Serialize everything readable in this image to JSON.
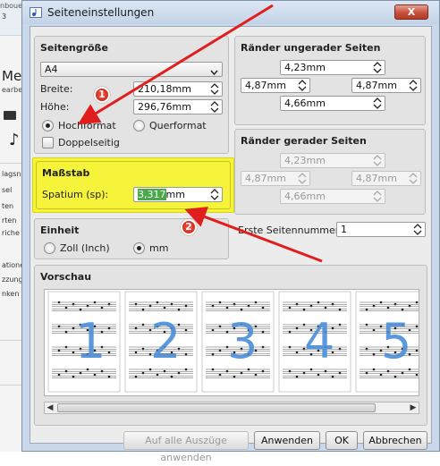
{
  "background_app": {
    "title_fragment": "nbouensten",
    "number_fragment": "3",
    "heading_fragment": "Me",
    "subheading_fragment": "earbe",
    "left_items": [
      "lagsn",
      "sel",
      "ten",
      "rten",
      "riche",
      "ationen",
      "zzungen",
      "nken"
    ]
  },
  "dialog": {
    "title": "Seiteneinstellungen",
    "close_label": "X"
  },
  "page_size": {
    "title": "Seitengröße",
    "paper_format": "A4",
    "width_label": "Breite:",
    "width_value": "210,18mm",
    "height_label": "Höhe:",
    "height_value": "296,76mm",
    "portrait_label": "Hochformat",
    "landscape_label": "Querformat",
    "double_sided_label": "Doppelseitig"
  },
  "margins_odd": {
    "title": "Ränder ungerader Seiten",
    "top": "4,23mm",
    "left": "4,87mm",
    "right": "4,87mm",
    "bottom": "4,66mm"
  },
  "margins_even": {
    "title": "Ränder gerader Seiten",
    "top": "4,23mm",
    "left": "4,87mm",
    "right": "4,87mm",
    "bottom": "4,66mm"
  },
  "scale": {
    "title": "Maßstab",
    "spatium_label": "Spatium (sp):",
    "spatium_value": "3,317mm",
    "spatium_selected": "3,317",
    "spatium_unit": "mm"
  },
  "unit": {
    "title": "Einheit",
    "inch_label": "Zoll (Inch)",
    "mm_label": "mm"
  },
  "first_page": {
    "label": "Erste Seitennummer:",
    "value": "1"
  },
  "preview": {
    "title": "Vorschau",
    "page_numbers": [
      "1",
      "2",
      "3",
      "4",
      "5"
    ]
  },
  "buttons": {
    "apply_all": "Auf alle Auszüge anwenden",
    "apply": "Anwenden",
    "ok": "OK",
    "cancel": "Abbrechen"
  },
  "annotations": {
    "marker_1": "1",
    "marker_2": "2",
    "arrow_color": "#e01e1e"
  },
  "colors": {
    "highlight": "#f5f33a",
    "selection": "#4aa84a",
    "preview_numbers": "#4b8fd9"
  }
}
